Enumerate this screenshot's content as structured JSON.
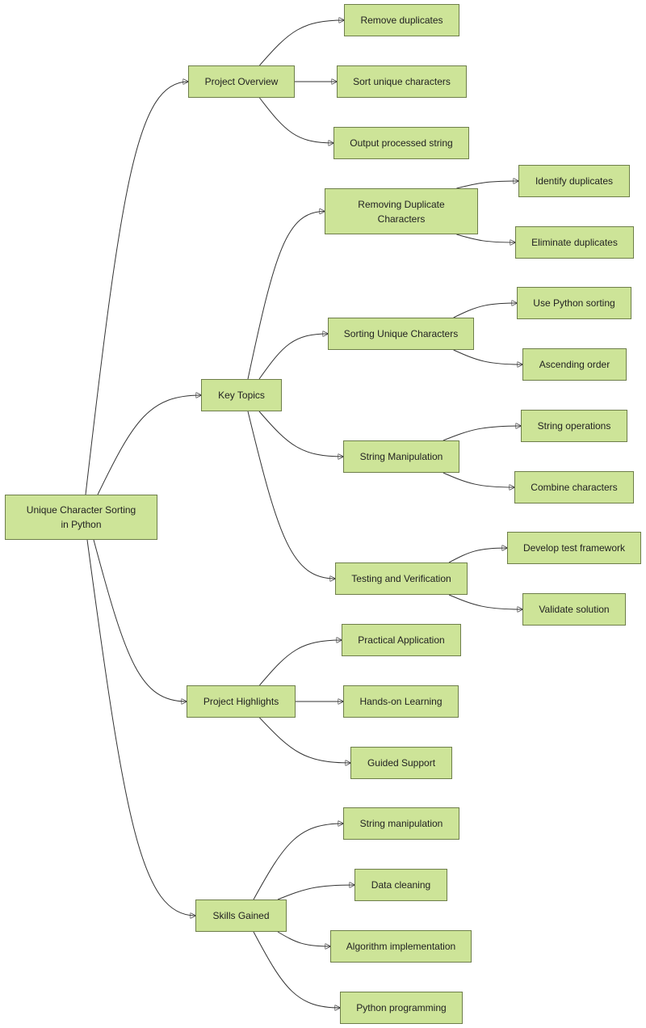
{
  "diagram": {
    "type": "mindmap-flowchart",
    "colors": {
      "node_fill": "#cde498",
      "node_border": "#6e7e4a",
      "edge": "#333333",
      "text": "#222222"
    },
    "root": {
      "id": "root",
      "label": "Unique Character Sorting in Python"
    },
    "nodes": [
      {
        "id": "overview",
        "label": "Project Overview",
        "parent": "root"
      },
      {
        "id": "ov1",
        "label": "Remove duplicates",
        "parent": "overview"
      },
      {
        "id": "ov2",
        "label": "Sort unique characters",
        "parent": "overview"
      },
      {
        "id": "ov3",
        "label": "Output processed string",
        "parent": "overview"
      },
      {
        "id": "topics",
        "label": "Key Topics",
        "parent": "root"
      },
      {
        "id": "t1",
        "label": "Removing Duplicate Characters",
        "parent": "topics"
      },
      {
        "id": "t1a",
        "label": "Identify duplicates",
        "parent": "t1"
      },
      {
        "id": "t1b",
        "label": "Eliminate duplicates",
        "parent": "t1"
      },
      {
        "id": "t2",
        "label": "Sorting Unique Characters",
        "parent": "topics"
      },
      {
        "id": "t2a",
        "label": "Use Python sorting",
        "parent": "t2"
      },
      {
        "id": "t2b",
        "label": "Ascending order",
        "parent": "t2"
      },
      {
        "id": "t3",
        "label": "String Manipulation",
        "parent": "topics"
      },
      {
        "id": "t3a",
        "label": "String operations",
        "parent": "t3"
      },
      {
        "id": "t3b",
        "label": "Combine characters",
        "parent": "t3"
      },
      {
        "id": "t4",
        "label": "Testing and Verification",
        "parent": "topics"
      },
      {
        "id": "t4a",
        "label": "Develop test framework",
        "parent": "t4"
      },
      {
        "id": "t4b",
        "label": "Validate solution",
        "parent": "t4"
      },
      {
        "id": "highlights",
        "label": "Project Highlights",
        "parent": "root"
      },
      {
        "id": "h1",
        "label": "Practical Application",
        "parent": "highlights"
      },
      {
        "id": "h2",
        "label": "Hands-on Learning",
        "parent": "highlights"
      },
      {
        "id": "h3",
        "label": "Guided Support",
        "parent": "highlights"
      },
      {
        "id": "skills",
        "label": "Skills Gained",
        "parent": "root"
      },
      {
        "id": "s1",
        "label": "String manipulation",
        "parent": "skills"
      },
      {
        "id": "s2",
        "label": "Data cleaning",
        "parent": "skills"
      },
      {
        "id": "s3",
        "label": "Algorithm implementation",
        "parent": "skills"
      },
      {
        "id": "s4",
        "label": "Python programming",
        "parent": "skills"
      }
    ]
  }
}
